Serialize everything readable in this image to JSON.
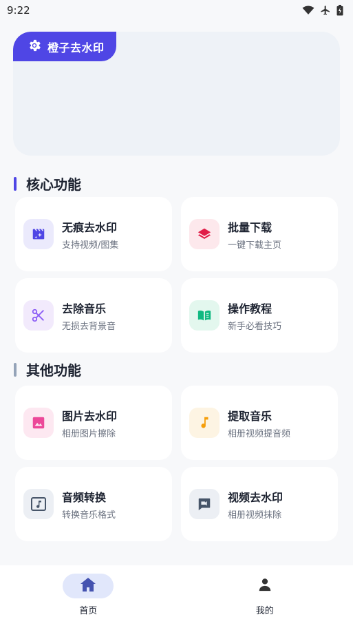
{
  "status_bar": {
    "time": "9:22"
  },
  "banner": {
    "tag_label": "橙子去水印"
  },
  "core_section": {
    "title": "核心功能",
    "accent": "#4f46e5",
    "cards": [
      {
        "title": "无痕去水印",
        "subtitle": "支持视频/图集",
        "icon": "video-sparkle-icon"
      },
      {
        "title": "批量下载",
        "subtitle": "一键下载主页",
        "icon": "layers-icon"
      },
      {
        "title": "去除音乐",
        "subtitle": "无损去背景音",
        "icon": "scissors-icon"
      },
      {
        "title": "操作教程",
        "subtitle": "新手必看技巧",
        "icon": "book-icon"
      }
    ]
  },
  "other_section": {
    "title": "其他功能",
    "accent": "#94a3b8",
    "cards": [
      {
        "title": "图片去水印",
        "subtitle": "相册图片擦除",
        "icon": "image-icon"
      },
      {
        "title": "提取音乐",
        "subtitle": "相册视频提音频",
        "icon": "music-note-icon"
      },
      {
        "title": "音频转换",
        "subtitle": "转换音乐格式",
        "icon": "audio-file-icon"
      },
      {
        "title": "视频去水印",
        "subtitle": "相册视频抹除",
        "icon": "video-chat-icon"
      }
    ]
  },
  "bottom_nav": {
    "items": [
      {
        "label": "首页",
        "icon": "home-icon",
        "active": true
      },
      {
        "label": "我的",
        "icon": "person-icon",
        "active": false
      }
    ]
  }
}
